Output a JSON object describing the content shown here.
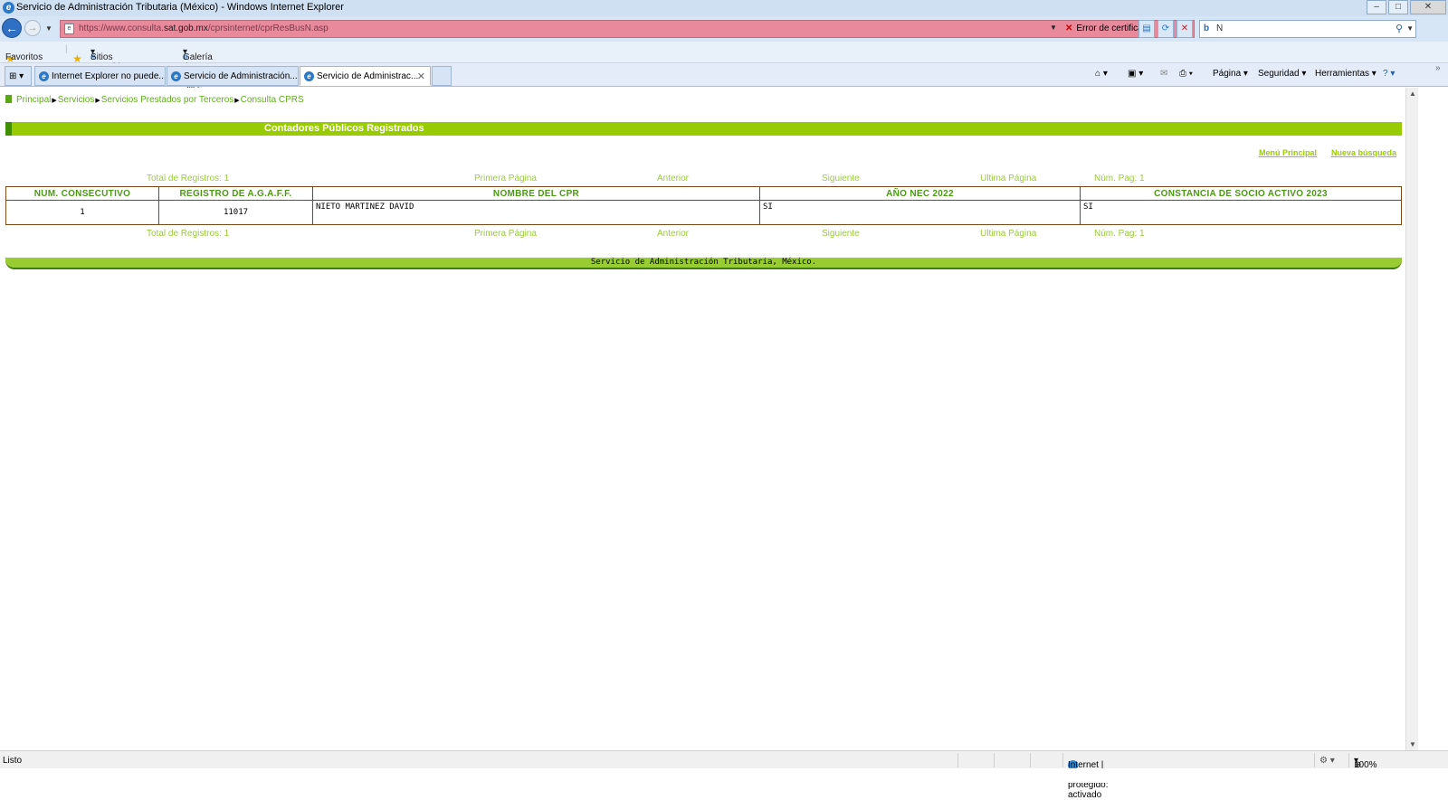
{
  "window": {
    "title": "Servicio de Administración Tributaria (México) - Windows Internet Explorer"
  },
  "nav": {
    "url_prefix": "https://www.consulta.",
    "url_domain": "sat.gob.mx",
    "url_path": "/cprsinternet/cprResBusN.asp",
    "cert_error": "Error de certificado",
    "search_value": "N"
  },
  "favorites": {
    "favorites_label": "Favoritos",
    "suggested": "Sitios sugeridos",
    "webslice": "Galería de Web Slice"
  },
  "tabs": [
    {
      "label": "Internet Explorer no puede..."
    },
    {
      "label": "Servicio de Administración..."
    },
    {
      "label": "Servicio de Administrac..."
    }
  ],
  "commands": {
    "page": "Página",
    "security": "Seguridad",
    "tools": "Herramientas"
  },
  "breadcrumb": [
    "Principal",
    "Servicios",
    "Servicios Prestados por Terceros",
    "Consulta CPRS"
  ],
  "section_title": "Contadores Públicos Registrados",
  "links": {
    "main_menu": "Menú Principal",
    "new_search": "Nueva búsqueda"
  },
  "pager": {
    "total": "Total de Registros: 1",
    "first": "Primera Página",
    "prev": "Anterior",
    "next": "Siguiente",
    "last": "Ultima Página",
    "page_num": "Núm. Pag: 1"
  },
  "table": {
    "headers": [
      "NUM. CONSECUTIVO",
      "REGISTRO DE A.G.A.F.F.",
      "NOMBRE DEL CPR",
      "AÑO NEC 2022",
      "CONSTANCIA DE SOCIO ACTIVO 2023"
    ],
    "rows": [
      [
        "1",
        "11017",
        "NIETO MARTINEZ DAVID",
        "SI",
        "SI"
      ]
    ]
  },
  "footer": "Servicio de Administración Tributaria, México.",
  "status": {
    "left": "Listo",
    "zone": "Internet | Modo protegido: activado",
    "zoom": "100%"
  },
  "colors": {
    "green_bar": "#99cc00",
    "link_green": "#99cc33",
    "header_green": "#4a9a12",
    "address_error": "#e88a9c"
  }
}
